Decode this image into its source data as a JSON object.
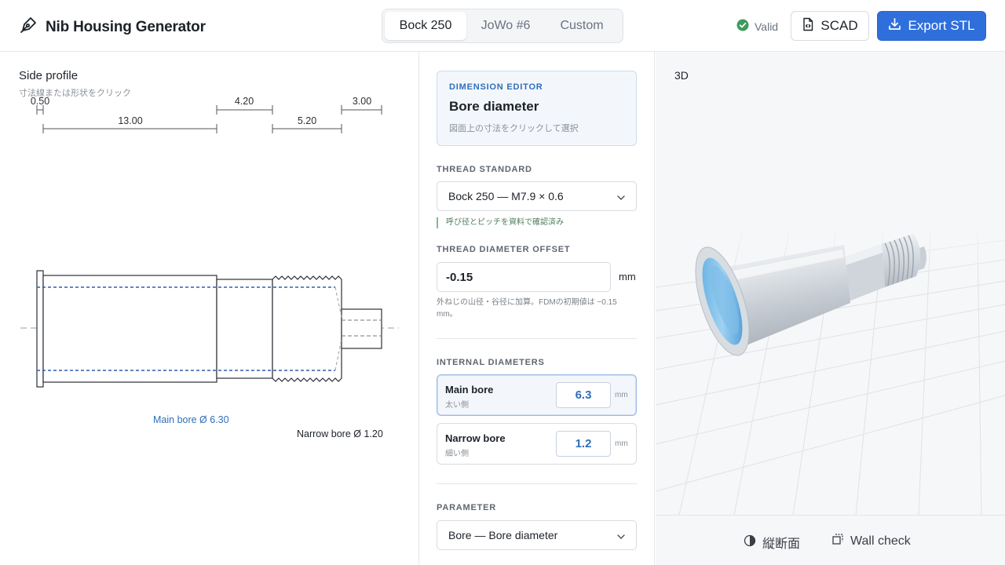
{
  "header": {
    "app_title": "Nib Housing Generator",
    "tabs": [
      {
        "label": "Bock 250",
        "active": true
      },
      {
        "label": "JoWo #6",
        "active": false
      },
      {
        "label": "Custom",
        "active": false
      }
    ],
    "status_label": "Valid",
    "scad_label": "SCAD",
    "export_label": "Export STL",
    "accent_color": "#2f6fdc"
  },
  "profile": {
    "title": "Side profile",
    "subtitle": "寸法線または形状をクリック",
    "dimensions": {
      "flange": "0.50",
      "main_length": "13.00",
      "mid_length": "4.20",
      "thread_length": "5.20",
      "tip_length": "3.00"
    },
    "main_bore_caption": "Main bore Ø 6.30",
    "narrow_bore_caption": "Narrow bore Ø 1.20"
  },
  "editor": {
    "kicker": "DIMENSION EDITOR",
    "title": "Bore diameter",
    "hint": "図面上の寸法をクリックして選択",
    "thread_standard_label": "THREAD STANDARD",
    "thread_standard_value": "Bock 250 — M7.9 × 0.6",
    "thread_note": "呼び径とピッチを資料で確認済み",
    "offset_label": "THREAD DIAMETER OFFSET",
    "offset_value": "-0.15",
    "offset_unit": "mm",
    "offset_help": "外ねじの山径・谷径に加算。FDMの初期値は −0.15 mm。",
    "internal_label": "INTERNAL DIAMETERS",
    "bores": [
      {
        "name": "Main bore",
        "sub": "太い側",
        "value": "6.3",
        "unit": "mm",
        "active": true
      },
      {
        "name": "Narrow bore",
        "sub": "細い側",
        "value": "1.2",
        "unit": "mm",
        "active": false
      }
    ],
    "parameter_label": "PARAMETER",
    "parameter_value": "Bore — Bore diameter"
  },
  "viewer": {
    "title": "3D",
    "tools": [
      {
        "label": "縦断面",
        "icon": "half-circle-icon"
      },
      {
        "label": "Wall check",
        "icon": "wall-check-icon"
      }
    ]
  }
}
